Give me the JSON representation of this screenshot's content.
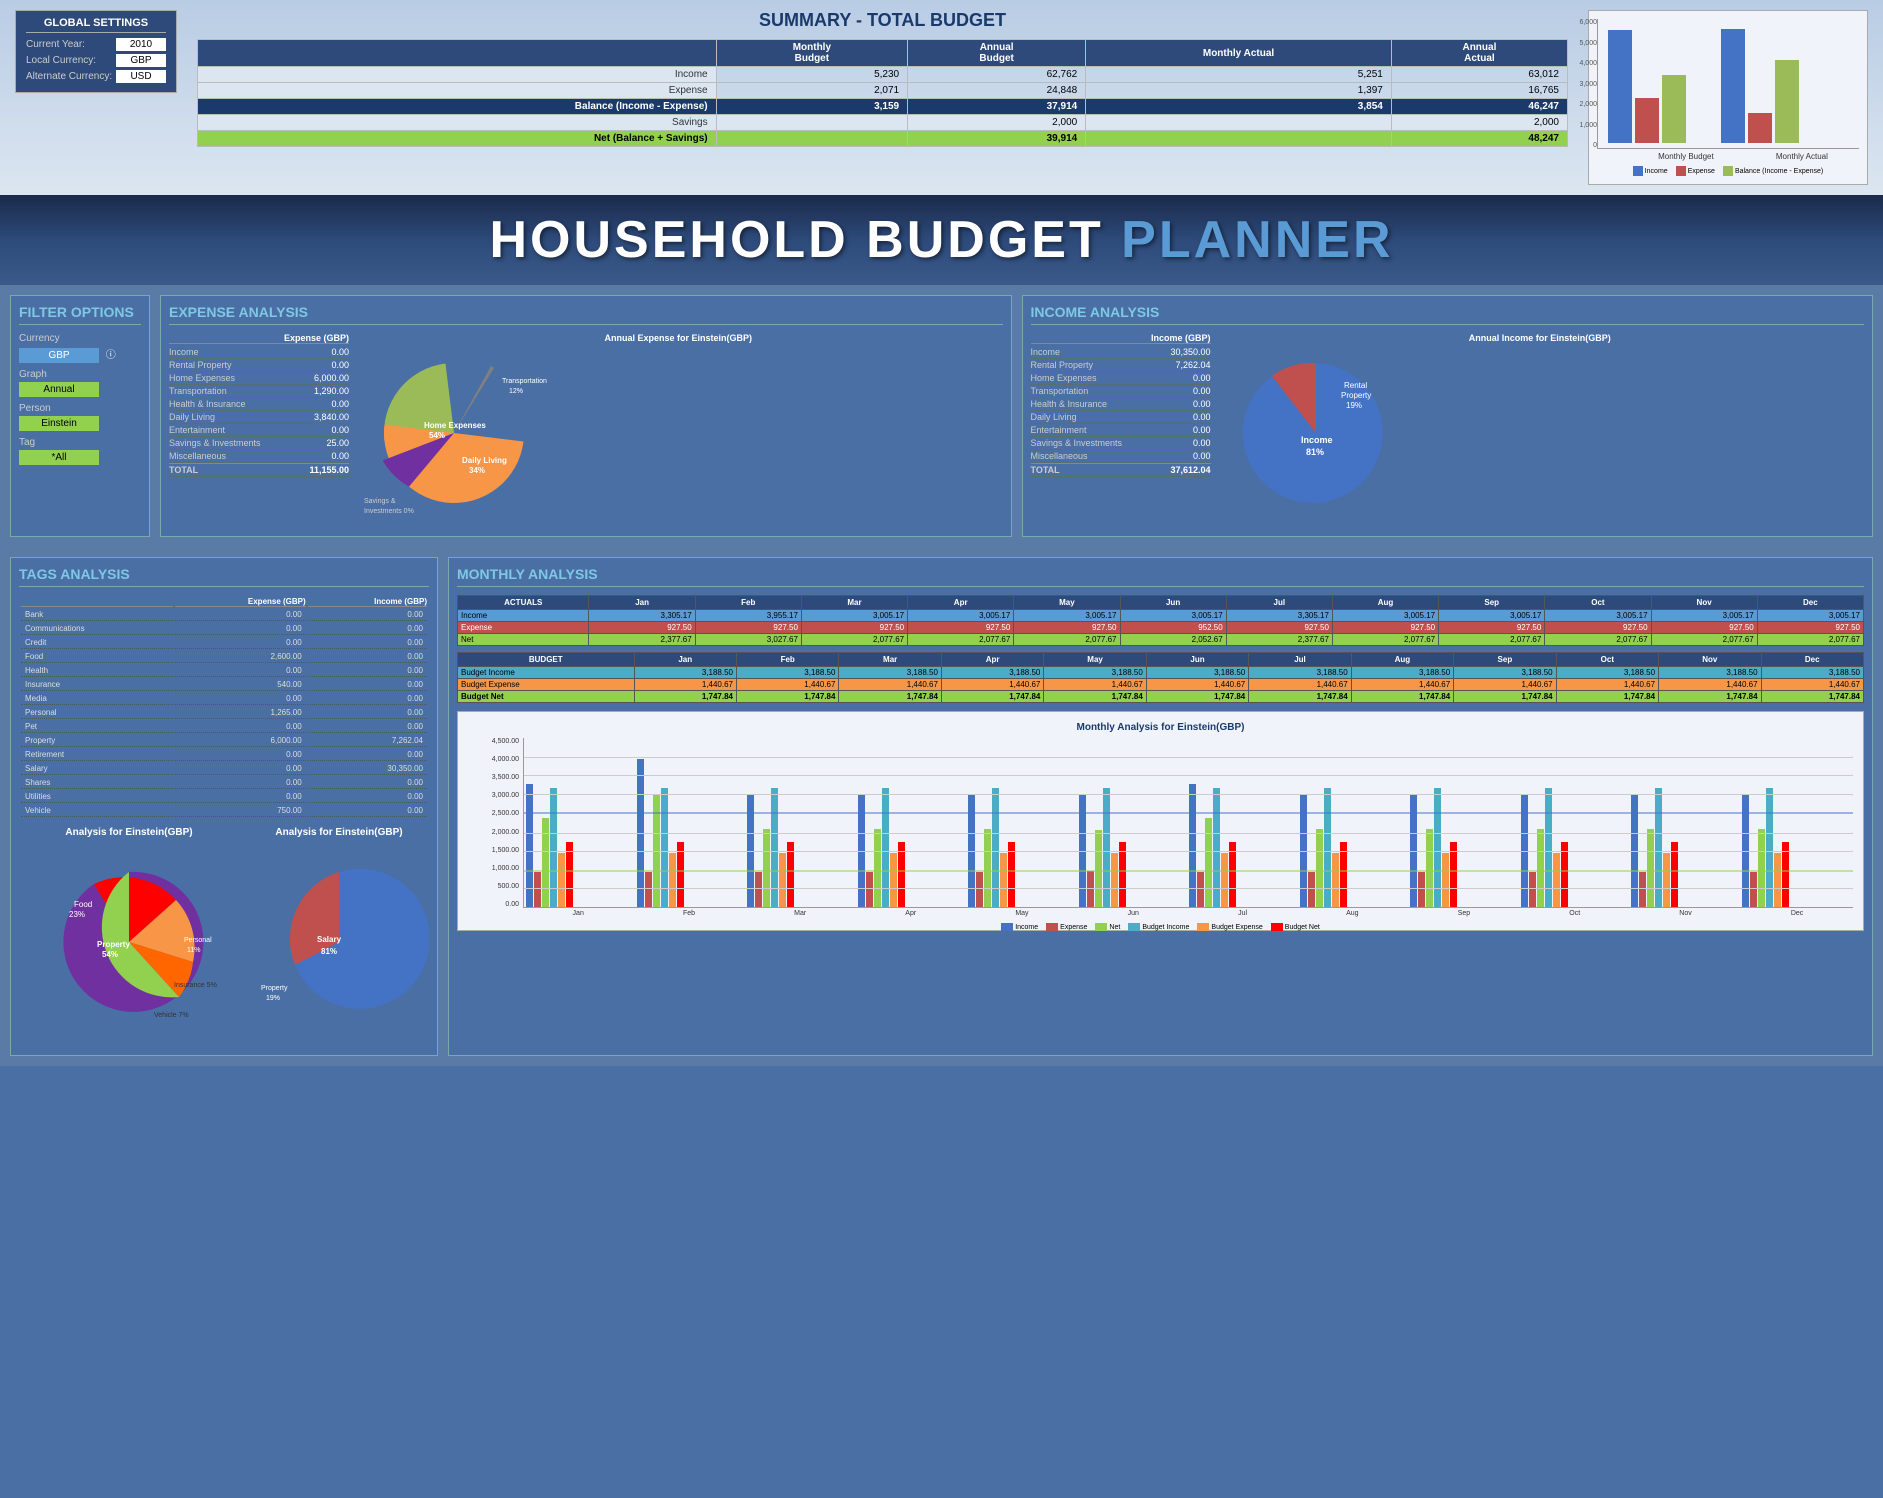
{
  "globalSettings": {
    "title": "GLOBAL SETTINGS",
    "currentYear": {
      "label": "Current Year:",
      "value": "2010"
    },
    "localCurrency": {
      "label": "Local Currency:",
      "value": "GBP"
    },
    "alternateCurrency": {
      "label": "Alternate Currency:",
      "value": "USD"
    }
  },
  "summary": {
    "title": "SUMMARY - TOTAL BUDGET",
    "headers": [
      "",
      "Monthly Budget",
      "Annual Budget",
      "Monthly Actual",
      "Annual Actual"
    ],
    "rows": [
      {
        "label": "Income",
        "monthlyBudget": "5,230",
        "annualBudget": "62,762",
        "monthlyActual": "5,251",
        "annualActual": "63,012"
      },
      {
        "label": "Expense",
        "monthlyBudget": "2,071",
        "annualBudget": "24,848",
        "monthlyActual": "1,397",
        "annualActual": "16,765"
      }
    ],
    "balance": {
      "label": "Balance (Income - Expense)",
      "monthlyBudget": "3,159",
      "annualBudget": "37,914",
      "monthlyActual": "3,854",
      "annualActual": "46,247"
    },
    "savings": {
      "label": "Savings",
      "annualBudget": "2,000",
      "annualActual": "2,000"
    },
    "net": {
      "label": "Net (Balance + Savings)",
      "annualBudget": "39,914",
      "annualActual": "48,247"
    }
  },
  "topChart": {
    "title": "",
    "yLabels": [
      "6,000",
      "5,000",
      "4,000",
      "3,000",
      "2,000",
      "1,000",
      "0"
    ],
    "groups": [
      {
        "label": "Monthly Budget",
        "bars": [
          {
            "label": "Income",
            "value": 5230,
            "maxVal": 6000,
            "color": "#4472c4"
          },
          {
            "label": "Expense",
            "value": 2071,
            "maxVal": 6000,
            "color": "#c0504d"
          },
          {
            "label": "Balance",
            "value": 3159,
            "maxVal": 6000,
            "color": "#9bbb59"
          }
        ]
      },
      {
        "label": "Monthly Actual",
        "bars": [
          {
            "label": "Income",
            "value": 5251,
            "maxVal": 6000,
            "color": "#4472c4"
          },
          {
            "label": "Expense",
            "value": 1397,
            "maxVal": 6000,
            "color": "#c0504d"
          },
          {
            "label": "Balance",
            "value": 3854,
            "maxVal": 6000,
            "color": "#9bbb59"
          }
        ]
      }
    ],
    "legend": [
      {
        "label": "Income",
        "color": "#4472c4"
      },
      {
        "label": "Expense",
        "color": "#c0504d"
      },
      {
        "label": "Balance (Income - Expense)",
        "color": "#9bbb59"
      }
    ]
  },
  "titleBanner": {
    "part1": "HOUSEHOLD BUDGET ",
    "part2": "PLANNER"
  },
  "filterOptions": {
    "title": "FILTER OPTIONS",
    "currency": {
      "label": "Currency",
      "value": "GBP"
    },
    "graph": {
      "label": "Graph",
      "value": "Annual"
    },
    "person": {
      "label": "Person",
      "value": "Einstein"
    },
    "tag": {
      "label": "Tag",
      "value": "*All"
    }
  },
  "expenseAnalysis": {
    "title": "EXPENSE ANALYSIS",
    "pieTitle": "Annual Expense for Einstein(GBP)",
    "tableHeaders": [
      "",
      "Expense (GBP)"
    ],
    "rows": [
      {
        "label": "Income",
        "value": "0.00"
      },
      {
        "label": "Rental Property",
        "value": "0.00"
      },
      {
        "label": "Home Expenses",
        "value": "6,000.00"
      },
      {
        "label": "Transportation",
        "value": "1,290.00"
      },
      {
        "label": "Health & Insurance",
        "value": "0.00"
      },
      {
        "label": "Daily Living",
        "value": "3,840.00"
      },
      {
        "label": "Entertainment",
        "value": "0.00"
      },
      {
        "label": "Savings & Investments",
        "value": "25.00"
      },
      {
        "label": "Miscellaneous",
        "value": "0.00"
      },
      {
        "label": "TOTAL",
        "value": "11,155.00"
      }
    ],
    "pieSlices": [
      {
        "label": "Home Expenses",
        "pct": 54,
        "color": "#9bbb59",
        "labelPct": "54%"
      },
      {
        "label": "Daily Living",
        "pct": 34,
        "color": "#f79646",
        "labelPct": "34%"
      },
      {
        "label": "Transportation",
        "pct": 12,
        "color": "#7030a0",
        "labelPct": "12%"
      },
      {
        "label": "Savings & Investments",
        "pct": 0,
        "color": "#c0504d",
        "labelPct": "0%"
      }
    ]
  },
  "incomeAnalysis": {
    "title": "INCOME ANALYSIS",
    "pieTitle": "Annual Income for Einstein(GBP)",
    "tableHeaders": [
      "",
      "Income (GBP)"
    ],
    "rows": [
      {
        "label": "Income",
        "value": "30,350.00"
      },
      {
        "label": "Rental Property",
        "value": "7,262.04"
      },
      {
        "label": "Home Expenses",
        "value": "0.00"
      },
      {
        "label": "Transportation",
        "value": "0.00"
      },
      {
        "label": "Health & Insurance",
        "value": "0.00"
      },
      {
        "label": "Daily Living",
        "value": "0.00"
      },
      {
        "label": "Entertainment",
        "value": "0.00"
      },
      {
        "label": "Savings & Investments",
        "value": "0.00"
      },
      {
        "label": "Miscellaneous",
        "value": "0.00"
      },
      {
        "label": "TOTAL",
        "value": "37,612.04"
      }
    ],
    "pieSlices": [
      {
        "label": "Income",
        "pct": 81,
        "color": "#4472c4",
        "labelPct": "81%"
      },
      {
        "label": "Rental Property",
        "pct": 19,
        "color": "#c0504d",
        "labelPct": "19%"
      }
    ]
  },
  "tagsAnalysis": {
    "title": "TAGS ANALYSIS",
    "headers": [
      "",
      "Expense (GBP)",
      "Income (GBP)"
    ],
    "rows": [
      {
        "tag": "Bank",
        "expense": "0.00",
        "income": "0.00"
      },
      {
        "tag": "Communications",
        "expense": "0.00",
        "income": "0.00"
      },
      {
        "tag": "Credit",
        "expense": "0.00",
        "income": "0.00"
      },
      {
        "tag": "Food",
        "expense": "2,600.00",
        "income": "0.00"
      },
      {
        "tag": "Health",
        "expense": "0.00",
        "income": "0.00"
      },
      {
        "tag": "Insurance",
        "expense": "540.00",
        "income": "0.00"
      },
      {
        "tag": "Media",
        "expense": "0.00",
        "income": "0.00"
      },
      {
        "tag": "Personal",
        "expense": "1,265.00",
        "income": "0.00"
      },
      {
        "tag": "Pet",
        "expense": "0.00",
        "income": "0.00"
      },
      {
        "tag": "Property",
        "expense": "6,000.00",
        "income": "7,262.04"
      },
      {
        "tag": "Retirement",
        "expense": "0.00",
        "income": "0.00"
      },
      {
        "tag": "Salary",
        "expense": "0.00",
        "income": "30,350.00"
      },
      {
        "tag": "Shares",
        "expense": "0.00",
        "income": "0.00"
      },
      {
        "tag": "Utilities",
        "expense": "0.00",
        "income": "0.00"
      },
      {
        "tag": "Vehicle",
        "expense": "750.00",
        "income": "0.00"
      }
    ],
    "tagsPie1": {
      "title": "Analysis for Einstein(GBP)",
      "slices": [
        {
          "label": "Property",
          "pct": 54,
          "color": "#7030a0",
          "labelPct": "54%"
        },
        {
          "label": "Food",
          "pct": 23,
          "color": "#ff0000",
          "labelPct": "23%"
        },
        {
          "label": "Personal",
          "pct": 11,
          "color": "#f79646",
          "labelPct": "11%"
        },
        {
          "label": "Insurance",
          "pct": 5,
          "color": "#ff6600",
          "labelPct": "5%"
        },
        {
          "label": "Vehicle",
          "pct": 7,
          "color": "#92d050",
          "labelPct": "7%"
        }
      ]
    },
    "tagsPie2": {
      "title": "Analysis for Einstein(GBP)",
      "slices": [
        {
          "label": "Salary",
          "pct": 81,
          "color": "#4472c4",
          "labelPct": "81%"
        },
        {
          "label": "Property",
          "pct": 19,
          "color": "#c0504d",
          "labelPct": "19%"
        }
      ]
    }
  },
  "monthlyAnalysis": {
    "title": "MONTHLY ANALYSIS",
    "actualsHeader": "ACTUALS",
    "budgetHeader": "BUDGET",
    "months": [
      "Jan",
      "Feb",
      "Mar",
      "Apr",
      "May",
      "Jun",
      "Jul",
      "Aug",
      "Sep",
      "Oct",
      "Nov",
      "Dec"
    ],
    "actualsRows": [
      {
        "label": "Income",
        "values": [
          "3,305.17",
          "3,955.17",
          "3,005.17",
          "3,005.17",
          "3,005.17",
          "3,005.17",
          "3,305.17",
          "3,005.17",
          "3,005.17",
          "3,005.17",
          "3,005.17",
          "3,005.17"
        ]
      },
      {
        "label": "Expense",
        "values": [
          "927.50",
          "927.50",
          "927.50",
          "927.50",
          "927.50",
          "952.50",
          "927.50",
          "927.50",
          "927.50",
          "927.50",
          "927.50",
          "927.50"
        ]
      },
      {
        "label": "Net",
        "values": [
          "2,377.67",
          "3,027.67",
          "2,077.67",
          "2,077.67",
          "2,077.67",
          "2,052.67",
          "2,377.67",
          "2,077.67",
          "2,077.67",
          "2,077.67",
          "2,077.67",
          "2,077.67"
        ]
      }
    ],
    "budgetRows": [
      {
        "label": "Budget Income",
        "values": [
          "3,188.50",
          "3,188.50",
          "3,188.50",
          "3,188.50",
          "3,188.50",
          "3,188.50",
          "3,188.50",
          "3,188.50",
          "3,188.50",
          "3,188.50",
          "3,188.50",
          "3,188.50"
        ]
      },
      {
        "label": "Budget Expense",
        "values": [
          "1,440.67",
          "1,440.67",
          "1,440.67",
          "1,440.67",
          "1,440.67",
          "1,440.67",
          "1,440.67",
          "1,440.67",
          "1,440.67",
          "1,440.67",
          "1,440.67",
          "1,440.67"
        ]
      },
      {
        "label": "Budget Net",
        "values": [
          "1,747.84",
          "1,747.84",
          "1,747.84",
          "1,747.84",
          "1,747.84",
          "1,747.84",
          "1,747.84",
          "1,747.84",
          "1,747.84",
          "1,747.84",
          "1,747.84",
          "1,747.84"
        ]
      }
    ],
    "monthlyChart": {
      "title": "Monthly Analysis for Einstein(GBP)",
      "yLabels": [
        "4,500.00",
        "4,000.00",
        "3,500.00",
        "3,000.00",
        "2,500.00",
        "2,000.00",
        "1,500.00",
        "1,000.00",
        "500.00",
        "0.00"
      ],
      "legend": [
        {
          "label": "Income",
          "color": "#4472c4"
        },
        {
          "label": "Expense",
          "color": "#c0504d"
        },
        {
          "label": "Net",
          "color": "#92d050"
        },
        {
          "label": "Budget Income",
          "color": "#4bacc6"
        },
        {
          "label": "Budget Expense",
          "color": "#f79646"
        },
        {
          "label": "Budget Net",
          "color": "#ff0000"
        }
      ]
    }
  }
}
